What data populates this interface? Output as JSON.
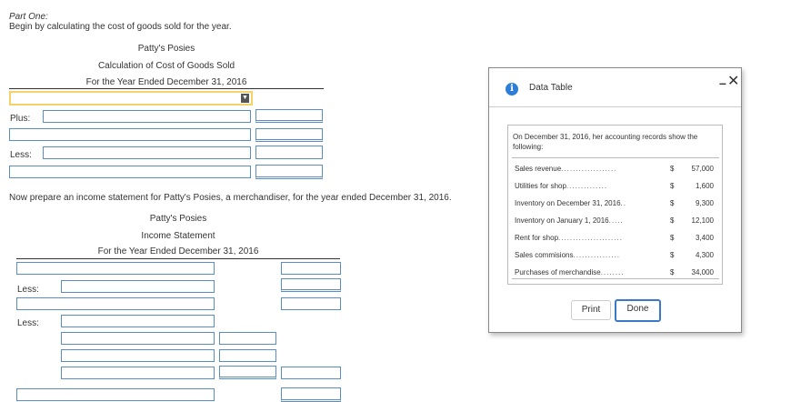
{
  "part": {
    "title": "Part One:",
    "instruction": "Begin by calculating the cost of goods sold for the year."
  },
  "cogs": {
    "company": "Patty's Posies",
    "statement": "Calculation of Cost of Goods Sold",
    "period": "For the Year Ended December 31, 2016",
    "select_value": "",
    "plus_label": "Plus:",
    "less_label": "Less:"
  },
  "income": {
    "instruction": "Now prepare an income statement for Patty's Posies, a merchandiser, for the year ended December 31, 2016.",
    "company": "Patty's Posies",
    "statement": "Income Statement",
    "period": "For the Year Ended December 31, 2016",
    "less_label_1": "Less:",
    "less_label_2": "Less:"
  },
  "modal": {
    "title": "Data Table",
    "intro": "On December 31, 2016, her accounting records show the following:",
    "rows": [
      {
        "label": "Sales revenue",
        "dots": "...................",
        "currency": "$",
        "value": "57,000"
      },
      {
        "label": "Utilities for shop",
        "dots": "..............",
        "currency": "$",
        "value": "1,600"
      },
      {
        "label": "Inventory on December 31, 2016",
        "dots": "..",
        "currency": "$",
        "value": "9,300"
      },
      {
        "label": "Inventory on January 1, 2016",
        "dots": ".....",
        "currency": "$",
        "value": "12,100"
      },
      {
        "label": "Rent for shop",
        "dots": "......................",
        "currency": "$",
        "value": "3,400"
      },
      {
        "label": "Sales commisions",
        "dots": "................",
        "currency": "$",
        "value": "4,300"
      },
      {
        "label": "Purchases of merchandise",
        "dots": "........",
        "currency": "$",
        "value": "34,000"
      }
    ],
    "print_label": "Print",
    "done_label": "Done",
    "minimize_symbol": "–",
    "close_symbol": "✕"
  }
}
